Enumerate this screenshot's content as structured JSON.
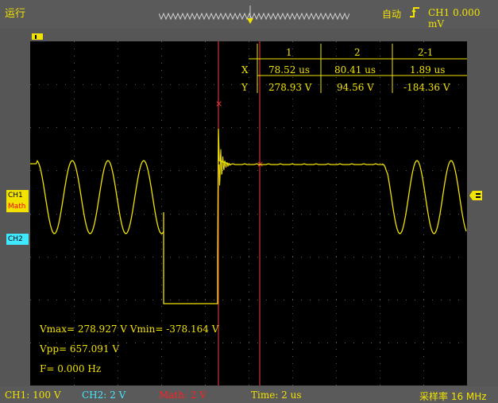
{
  "status": {
    "run_state": "运行",
    "trigger_mode": "自动",
    "trigger_readout": "CH1 0.000 mV"
  },
  "channels": {
    "ch1": {
      "label": "CH1",
      "color": "#f2e200"
    },
    "math": {
      "label": "Math",
      "color": "#ff2020"
    },
    "ch2": {
      "label": "CH2",
      "color": "#40e8ff"
    }
  },
  "cursor_table": {
    "headers": [
      "1",
      "2",
      "2-1"
    ],
    "rows": [
      {
        "label": "X",
        "values": [
          "78.52 us",
          "80.41 us",
          "1.89 us"
        ]
      },
      {
        "label": "Y",
        "values": [
          "278.93 V",
          "94.56 V",
          "-184.36 V"
        ]
      }
    ]
  },
  "measurements": {
    "vmax_vmin": "Vmax= 278.927 V  Vmin= -378.164 V",
    "vpp": "Vpp= 657.091 V",
    "freq": "F= 0.000 Hz"
  },
  "bottom": {
    "ch1_scale": "CH1: 100 V",
    "ch2_scale": "CH2: 2 V",
    "math_scale": "Math: 2 V",
    "time_scale": "Time: 2 us",
    "sample_rate": "采样率 16 MHz"
  },
  "colors": {
    "accent": "#f2e200",
    "cursor": "#ff3b3b",
    "ch2": "#40e8ff",
    "math": "#ff2020",
    "grid": "#5a5a5a"
  },
  "icons": [
    "rising-edge-trigger-icon",
    "trigger-position-marker-icon",
    "level-marker-icon"
  ]
}
